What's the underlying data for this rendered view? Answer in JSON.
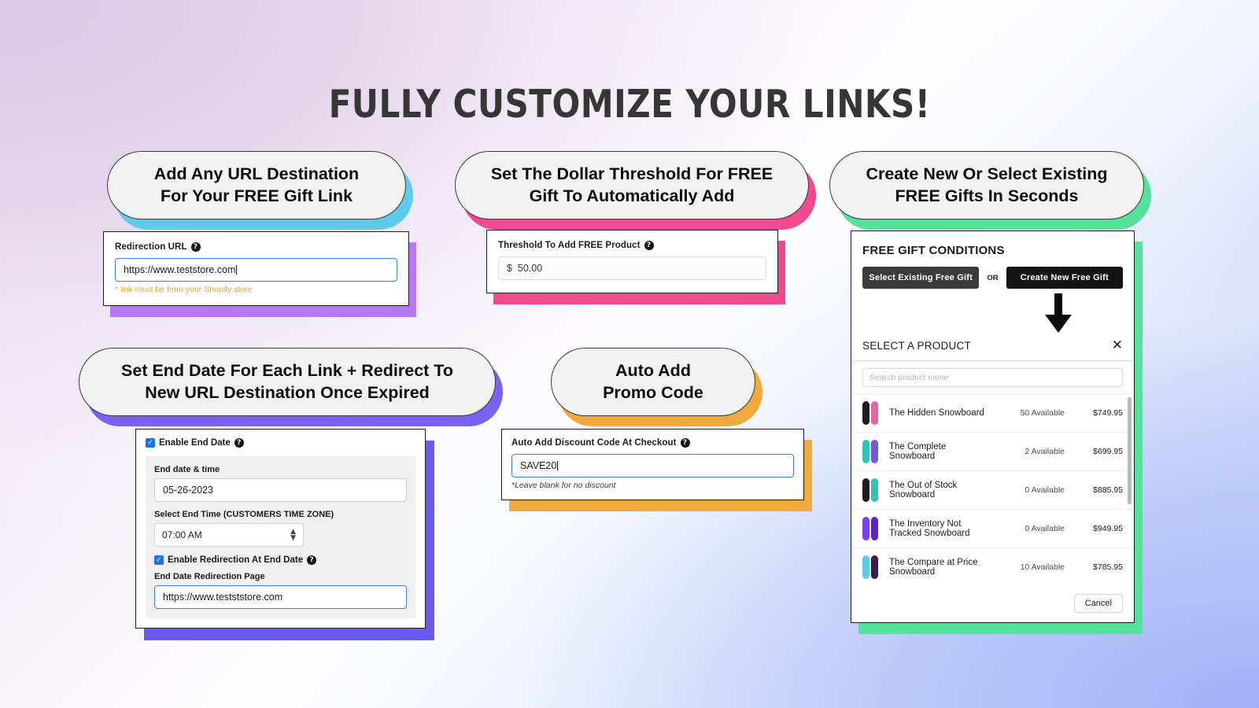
{
  "title": "FULLY CUSTOMIZE YOUR LINKS!",
  "colors": {
    "pill_shadow_1": "#5ecbe8",
    "pill_shadow_2": "#f2488f",
    "pill_shadow_3": "#55e39b",
    "pill_shadow_4": "#7b61f2",
    "pill_shadow_5": "#f0a93c",
    "card_shadow_1": "#b678f0",
    "card_shadow_2": "#f2488f",
    "card_shadow_3": "#55e39b",
    "card_shadow_4": "#6a5cf0",
    "card_shadow_5": "#f0a93c",
    "focus_blue": "#3b7df5",
    "hint_orange": "#f0a03a"
  },
  "pills": [
    {
      "id": "pill-url",
      "line1": "Add Any URL Destination",
      "line2": "For Your FREE Gift Link"
    },
    {
      "id": "pill-threshold",
      "line1": "Set The Dollar Threshold For FREE",
      "line2": "Gift To Automatically Add"
    },
    {
      "id": "pill-gift",
      "line1": "Create New Or Select Existing",
      "line2": "FREE Gifts In Seconds"
    },
    {
      "id": "pill-enddate",
      "line1": "Set End Date For Each Link + Redirect To",
      "line2": "New URL Destination Once Expired"
    },
    {
      "id": "pill-promo",
      "line1": "Auto Add",
      "line2": "Promo Code"
    }
  ],
  "card_redirect": {
    "label": "Redirection URL",
    "help_icon": "question-mark-icon",
    "value": "https://www.teststore.com",
    "hint": "* link must be from your Shopify store"
  },
  "card_threshold": {
    "label": "Threshold To Add FREE Product",
    "help_icon": "question-mark-icon",
    "currency": "$",
    "value": "50.00"
  },
  "card_gift": {
    "heading": "FREE GIFT CONDITIONS",
    "btn_existing": "Select Existing Free Gift",
    "or": "OR",
    "btn_create": "Create New Free Gift",
    "arrow_icon": "down-arrow-icon",
    "select_title": "SELECT A PRODUCT",
    "close_icon": "close-icon",
    "search_placeholder": "Search product name",
    "products": [
      {
        "name": "The Hidden Snowboard",
        "availability": "50 Available",
        "price": "$749.95",
        "c1": "#1f1f1f",
        "c2": "#f05fa0"
      },
      {
        "name": "The Complete Snowboard",
        "availability": "2 Available",
        "price": "$699.95",
        "c1": "#2ec4b6",
        "c2": "#6f5bd6"
      },
      {
        "name": "The Out of Stock Snowboard",
        "availability": "0 Available",
        "price": "$885.95",
        "c1": "#1f1f1f",
        "c2": "#2ec4b6"
      },
      {
        "name": "The Inventory Not Tracked Snowboard",
        "availability": "0 Available",
        "price": "$949.95",
        "c1": "#7b3ff2",
        "c2": "#5b23c9"
      },
      {
        "name": "The Compare at Price Snowboard",
        "availability": "10 Available",
        "price": "$785.95",
        "c1": "#5ecbe8",
        "c2": "#3a1f4d"
      }
    ],
    "cancel": "Cancel"
  },
  "card_enddate": {
    "enable_label": "Enable End Date",
    "enable_checked": true,
    "help_icon": "question-mark-icon",
    "date_label": "End date & time",
    "date_value": "05-26-2023",
    "time_label": "Select End Time (CUSTOMERS TIME ZONE)",
    "time_value": "07:00 AM",
    "redirect_enable_label": "Enable Redirection At End Date",
    "redirect_enable_checked": true,
    "redirect_label": "End Date Redirection Page",
    "redirect_value": "https://www.testststore.com"
  },
  "card_promo": {
    "label": "Auto Add Discount Code At Checkout",
    "help_icon": "question-mark-icon",
    "value": "SAVE20",
    "hint": "*Leave blank for no discount"
  }
}
